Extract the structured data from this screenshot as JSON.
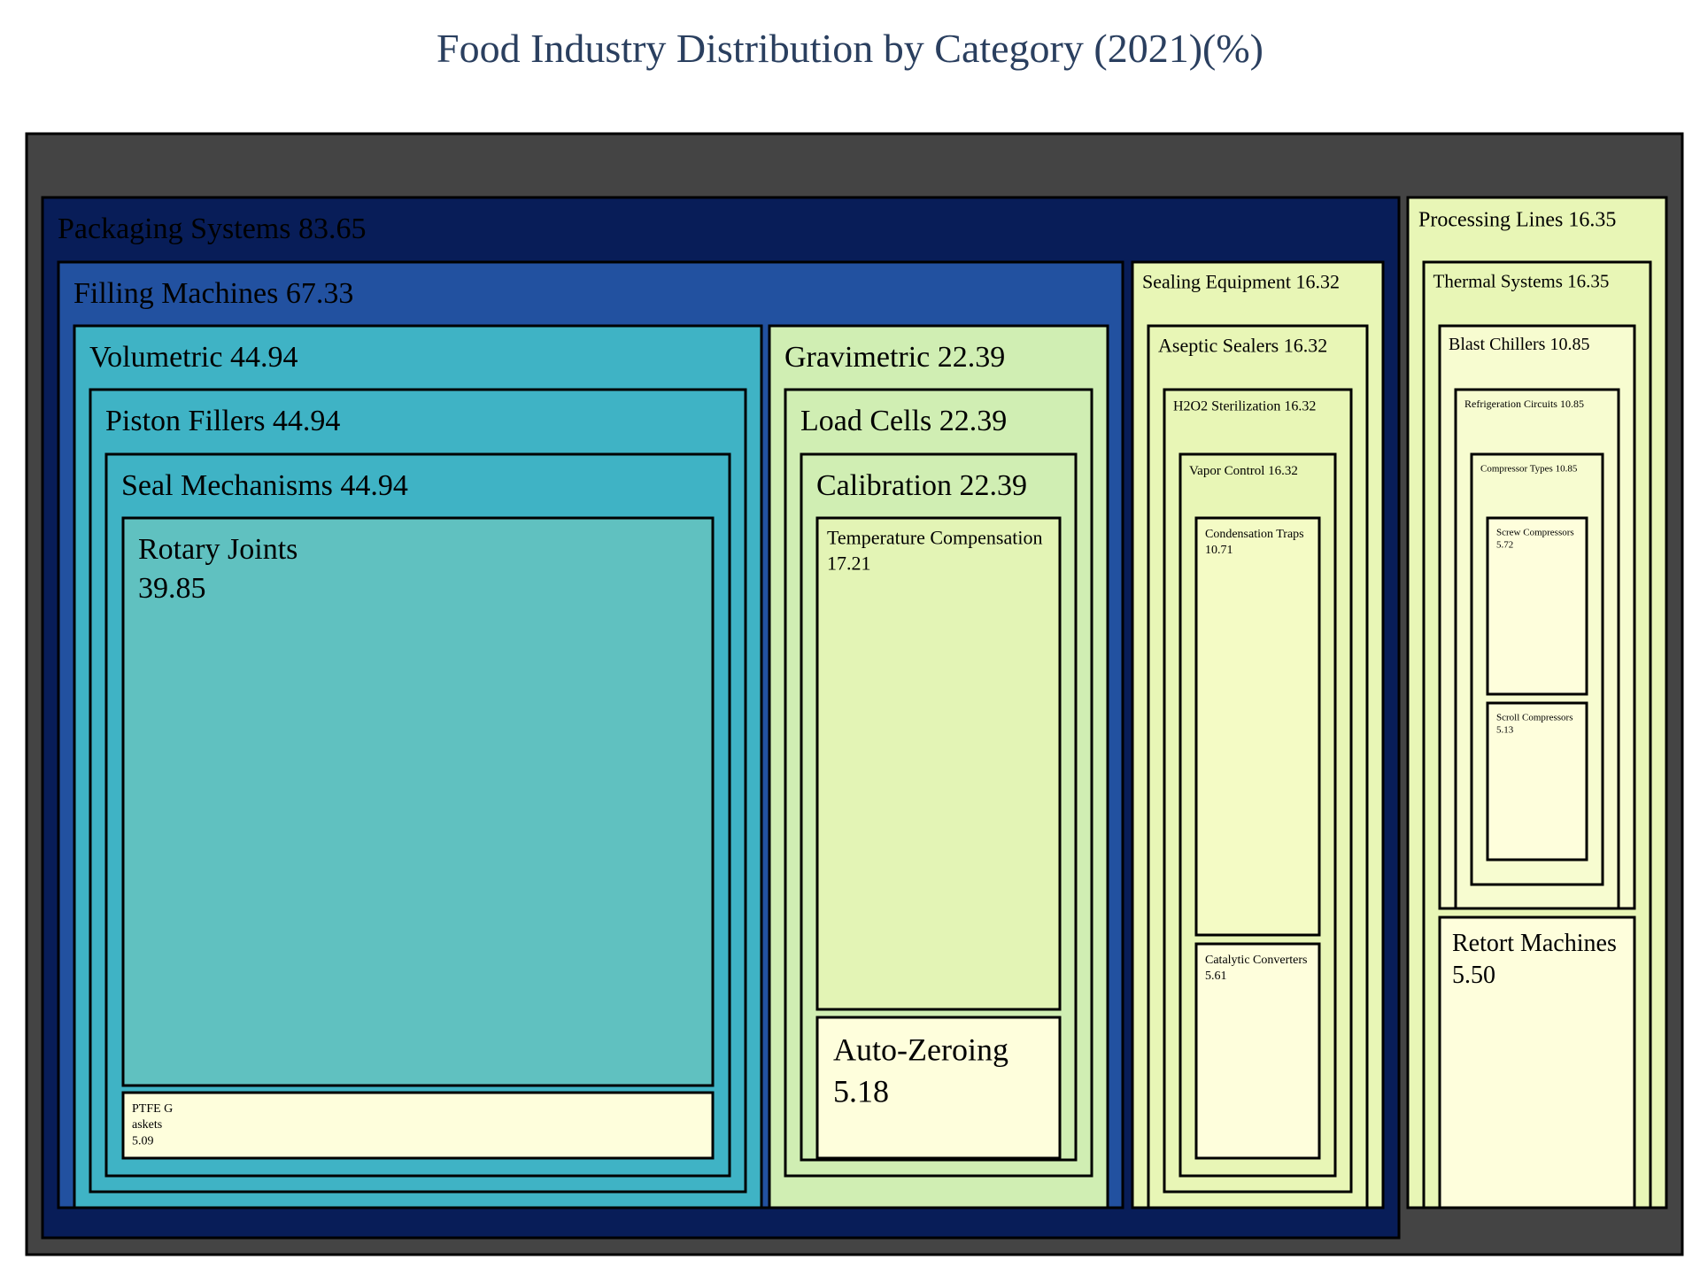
{
  "chart_data": {
    "type": "treemap",
    "title": "Food Industry Distribution by Category (2021)(%)",
    "unit": "%",
    "root_color": "#444444",
    "nodes": [
      {
        "id": "ps",
        "label": "Packaging Systems",
        "value": 83.65,
        "value_text": "83.65",
        "color": "#081d58",
        "children": [
          {
            "id": "fm",
            "label": "Filling Machines",
            "value": 67.33,
            "value_text": "67.33",
            "color": "#2251a0",
            "children": [
              {
                "id": "vol",
                "label": "Volumetric",
                "value": 44.94,
                "value_text": "44.94",
                "color": "#3fb3c5",
                "children": [
                  {
                    "id": "pf",
                    "label": "Piston Fillers",
                    "value": 44.94,
                    "value_text": "44.94",
                    "color": "#3fb3c5",
                    "children": [
                      {
                        "id": "sm",
                        "label": "Seal Mechanisms",
                        "value": 44.94,
                        "value_text": "44.94",
                        "color": "#3fb3c5",
                        "children": [
                          {
                            "id": "rj",
                            "label": "Rotary Joints",
                            "value": 39.85,
                            "value_text": "39.85",
                            "color": "#60c1c0"
                          },
                          {
                            "id": "ptfe",
                            "label": "PTFE Gaskets",
                            "label_lines": [
                              "PTFE G",
                              "askets"
                            ],
                            "value": 5.09,
                            "value_text": "5.09",
                            "color": "#fefedc"
                          }
                        ]
                      }
                    ]
                  }
                ]
              },
              {
                "id": "grav",
                "label": "Gravimetric",
                "value": 22.39,
                "value_text": "22.39",
                "color": "#d0eeb3",
                "children": [
                  {
                    "id": "lc",
                    "label": "Load Cells",
                    "value": 22.39,
                    "value_text": "22.39",
                    "color": "#d0eeb3",
                    "children": [
                      {
                        "id": "cal",
                        "label": "Calibration",
                        "value": 22.39,
                        "value_text": "22.39",
                        "color": "#d0eeb3",
                        "children": [
                          {
                            "id": "tc",
                            "label": "Temperature Compensation",
                            "value": 17.21,
                            "value_text": "17.21",
                            "color": "#e3f4b5"
                          },
                          {
                            "id": "az",
                            "label": "Auto-Zeroing",
                            "value": 5.18,
                            "value_text": "5.18",
                            "color": "#fefedc"
                          }
                        ]
                      }
                    ]
                  }
                ]
              }
            ]
          },
          {
            "id": "se",
            "label": "Sealing Equipment",
            "value": 16.32,
            "value_text": "16.32",
            "color": "#e8f6b6",
            "children": [
              {
                "id": "as",
                "label": "Aseptic Sealers",
                "value": 16.32,
                "value_text": "16.32",
                "color": "#e8f6b6",
                "children": [
                  {
                    "id": "h2o2",
                    "label": "H2O2 Sterilization",
                    "value": 16.32,
                    "value_text": "16.32",
                    "color": "#e8f6b6",
                    "children": [
                      {
                        "id": "vc",
                        "label": "Vapor Control",
                        "value": 16.32,
                        "value_text": "16.32",
                        "color": "#e8f6b6",
                        "children": [
                          {
                            "id": "ct",
                            "label": "Condensation Traps",
                            "value": 10.71,
                            "value_text": "10.71",
                            "color": "#f4fbc5"
                          },
                          {
                            "id": "cc",
                            "label": "Catalytic Converters",
                            "value": 5.61,
                            "value_text": "5.61",
                            "color": "#fefedc"
                          }
                        ]
                      }
                    ]
                  }
                ]
              }
            ]
          }
        ]
      },
      {
        "id": "pl",
        "label": "Processing Lines",
        "value": 16.35,
        "value_text": "16.35",
        "color": "#e8f6b6",
        "children": [
          {
            "id": "ts",
            "label": "Thermal Systems",
            "value": 16.35,
            "value_text": "16.35",
            "color": "#e8f6b6",
            "children": [
              {
                "id": "bc",
                "label": "Blast Chillers",
                "value": 10.85,
                "value_text": "10.85",
                "color": "#f7fcd0",
                "children": [
                  {
                    "id": "rc",
                    "label": "Refrigeration Circuits",
                    "value": 10.85,
                    "value_text": "10.85",
                    "color": "#f7fcd0",
                    "children": [
                      {
                        "id": "cty",
                        "label": "Compressor Types",
                        "value": 10.85,
                        "value_text": "10.85",
                        "color": "#f7fcd0",
                        "children": [
                          {
                            "id": "scr",
                            "label": "Screw Compressors",
                            "value": 5.72,
                            "value_text": "5.72",
                            "color": "#fefedc"
                          },
                          {
                            "id": "scl",
                            "label": "Scroll Compressors",
                            "value": 5.13,
                            "value_text": "5.13",
                            "color": "#fefedc"
                          }
                        ]
                      }
                    ]
                  }
                ]
              },
              {
                "id": "rm",
                "label": "Retort Machines",
                "value": 5.5,
                "value_text": "5.50",
                "color": "#fefedc"
              }
            ]
          }
        ]
      }
    ]
  }
}
